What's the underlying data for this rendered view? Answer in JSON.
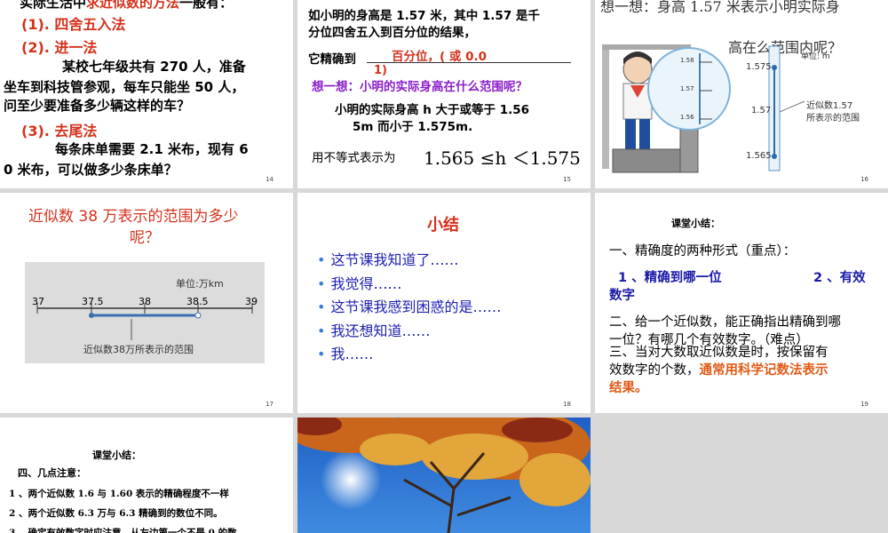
{
  "s14": {
    "line1_a": "实际生活中",
    "line1_b": "求近似数的方法",
    "line1_c": "一般有：",
    "m1": "(1). 四舍五入法",
    "m2": "(2). 进一法",
    "p1": "某校七年级共有 270 人，准备",
    "p2": "坐车到科技管参观，每车只能坐 50 人，",
    "p3": "问至少要准备多少辆这样的车？",
    "m3": "(3). 去尾法",
    "p4": "每条床单需要 2.1 米布，现有 6",
    "p5": "0 米布，可以做多少条床单？",
    "page": "14"
  },
  "s15": {
    "l1": "如小明的身高是 1.57 米，其中 1.57 是千",
    "l2": "分位四舍五入到百分位的结果，",
    "l3": "它精确到",
    "ans": "百分位，( 或 0.0",
    "ans2": "1)",
    "think": "想一想：小明的实际身高在什么范围呢？",
    "l4": "小明的实际身高 h 大于或等于 1.56",
    "l5": "5m 而小于 1.575m.",
    "l6": "用不等式表示为",
    "ineq": "1.565 ≤h ＜1.575",
    "page": "15"
  },
  "s16": {
    "q1": "想一想：身高 1.57 米表示小明实际身",
    "q2": "高在么范围内呢？",
    "unit": "单位: m",
    "r1": "1.575",
    "r2": "1.57",
    "r3": "1.565",
    "s1": "1.58",
    "s2": "1.57",
    "s3": "1.56",
    "note1": "近似数1.57",
    "note2": "所表示的范围",
    "page": "16"
  },
  "s17": {
    "title1": "近似数 38 万表示的范围为多少",
    "title2": "呢？",
    "unit": "单位:万km",
    "ticks": [
      "37",
      "37.5",
      "38",
      "38.5",
      "39"
    ],
    "caption": "近似数38万所表示的范围",
    "page": "17"
  },
  "s18": {
    "title": "小结",
    "items": [
      "这节课我知道了……",
      "我觉得……",
      "这节课我感到困惑的是……",
      "我还想知道……",
      "我……"
    ],
    "page": "18"
  },
  "s19": {
    "title": "课堂小结：",
    "l1": "一、精确度的两种形式（重点）：",
    "l2a": "1 、精确到哪一位",
    "l2b": "2 、有效",
    "l2c": "数字",
    "l3": "二、给一个近似数，能正确指出精确到哪",
    "l4": "一位？有哪几个有效数字。（难点）",
    "l5": "三、当对大数取近似数是时，按保留有",
    "l6": "效数字的个数，",
    "l6b": "通常用科学记数法表示",
    "l7": "结果。",
    "page": "19"
  },
  "s20": {
    "title": "课堂小结：",
    "l1": "四、几点注意：",
    "l2": "1 、两个近似数 1.6 与 1.60 表示的精确程度不一样",
    "l3": "2 、两个近似数 6.3 万与 6.3 精确到的数位不同。",
    "l4": "3 、确定有效数字时应注意，从左边第一个不是 0 的数"
  },
  "colors": {
    "red": "#d4321c",
    "blue": "#1a1aa8",
    "orange": "#e05a16"
  }
}
